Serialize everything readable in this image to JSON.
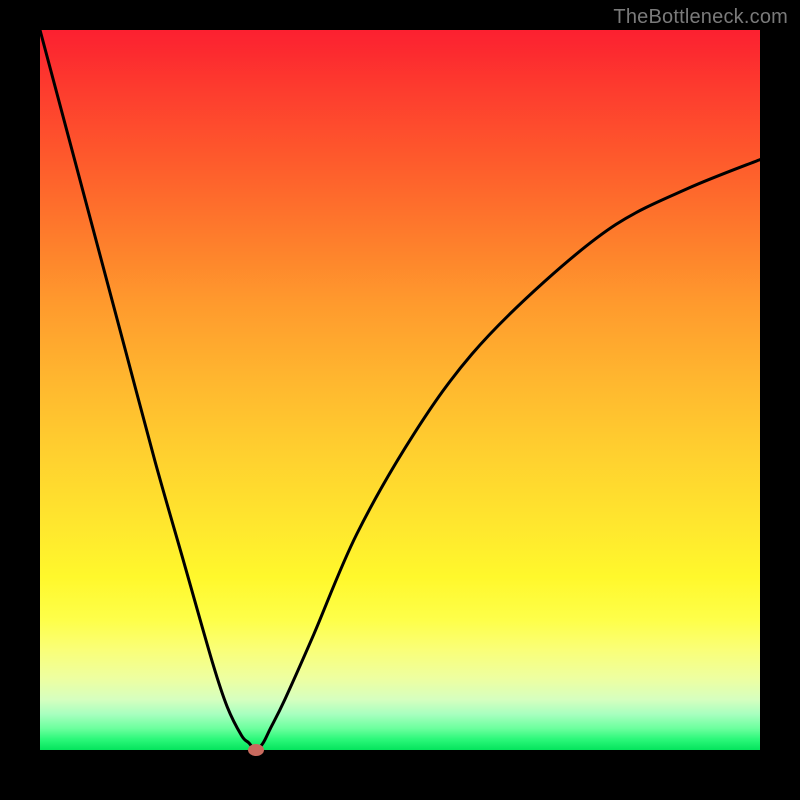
{
  "watermark": "TheBottleneck.com",
  "gradient_colors": {
    "top": "#fc2030",
    "mid": "#ffe52e",
    "bottom": "#05e45d"
  },
  "curve_color": "#000000",
  "marker_color": "#c96a5e",
  "chart_data": {
    "type": "line",
    "title": "",
    "xlabel": "",
    "ylabel": "",
    "xlim": [
      0,
      100
    ],
    "ylim": [
      0,
      100
    ],
    "series": [
      {
        "name": "bottleneck-curve",
        "x": [
          0,
          4,
          8,
          12,
          16,
          20,
          24,
          26,
          28,
          29,
          30,
          31,
          32,
          34,
          38,
          44,
          52,
          60,
          70,
          80,
          90,
          100
        ],
        "y": [
          100,
          85,
          70,
          55,
          40,
          26,
          12,
          6,
          2,
          1,
          0,
          1,
          3,
          7,
          16,
          30,
          44,
          55,
          65,
          73,
          78,
          82
        ]
      }
    ],
    "marker": {
      "x": 30,
      "y": 0
    },
    "annotations": []
  }
}
